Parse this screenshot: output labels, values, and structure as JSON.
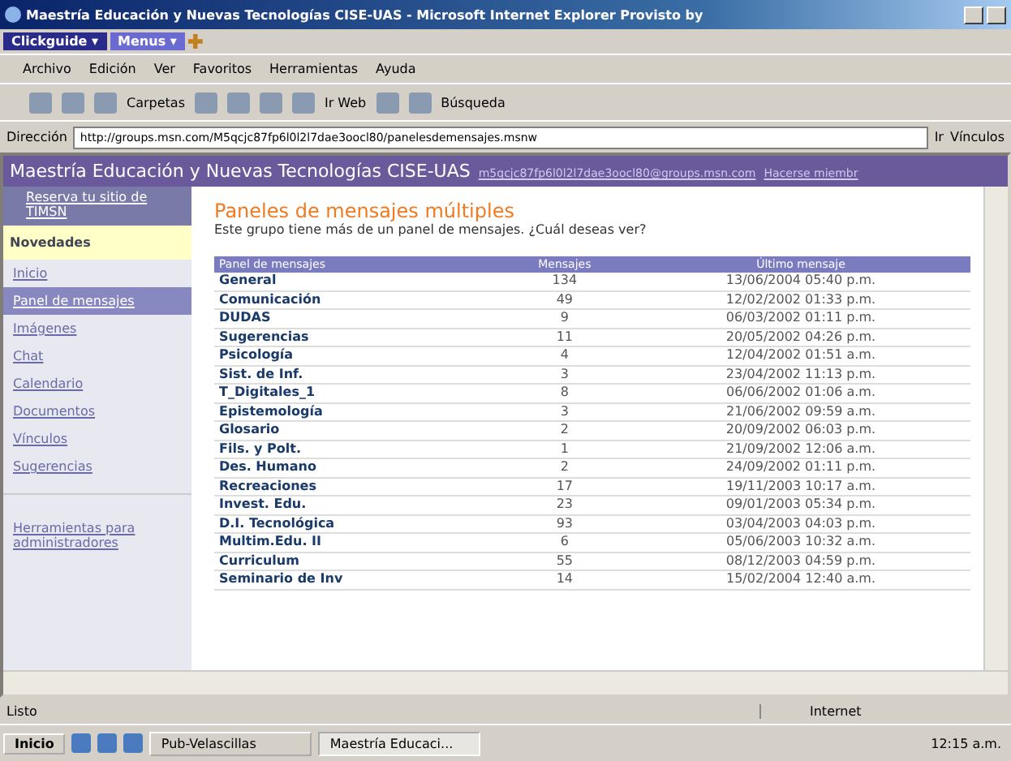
{
  "window": {
    "title": "Maestría Educación y Nuevas Tecnologías CISE-UAS - Microsoft Internet Explorer Provisto by"
  },
  "addon_bar": {
    "items": [
      "Clickguide ▾",
      "Menus ▾"
    ]
  },
  "menu_bar": [
    "Archivo",
    "Edición",
    "Ver",
    "Favoritos",
    "Herramientas",
    "Ayuda"
  ],
  "toolbar": {
    "folders": "Carpetas",
    "web": "Ir Web",
    "search": "Búsqueda"
  },
  "address_bar": {
    "label": "Dirección",
    "url": "http://groups.msn.com/M5qcjc87fp6l0l2l7dae3oocl80/panelesdemensajes.msnw",
    "go": "Ir",
    "links": "Vínculos"
  },
  "site_header": {
    "title": "Maestría Educación y Nuevas Tecnologías CISE-UAS",
    "email": "m5qcjc87fp6l0l2l7dae3oocl80@groups.msn.com",
    "join": "Hacerse miembr"
  },
  "sidebar": {
    "promo": "Reserva tu sitio de TIMSN",
    "news": "Novedades",
    "items": [
      {
        "label": "Inicio",
        "selected": false
      },
      {
        "label": "Panel de mensajes",
        "selected": true
      },
      {
        "label": "Imágenes",
        "selected": false
      },
      {
        "label": "Chat",
        "selected": false
      },
      {
        "label": "Calendario",
        "selected": false
      },
      {
        "label": "Documentos",
        "selected": false
      },
      {
        "label": "Vínculos",
        "selected": false
      },
      {
        "label": "Sugerencias",
        "selected": false
      }
    ],
    "admin": "Herramientas para administradores"
  },
  "content": {
    "heading": "Paneles de mensajes múltiples",
    "intro": "Este grupo tiene más de un panel de mensajes. ¿Cuál deseas ver?"
  },
  "table": {
    "columns": [
      "Panel de mensajes",
      "Mensajes",
      "Último mensaje"
    ],
    "rows": [
      [
        "General",
        "134",
        "13/06/2004 05:40 p.m."
      ],
      [
        "Comunicación",
        "49",
        "12/02/2002 01:33 p.m."
      ],
      [
        "DUDAS",
        "9",
        "06/03/2002 01:11 p.m."
      ],
      [
        "Sugerencias",
        "11",
        "20/05/2002 04:26 p.m."
      ],
      [
        "Psicología",
        "4",
        "12/04/2002 01:51 a.m."
      ],
      [
        "Sist. de Inf.",
        "3",
        "23/04/2002 11:13 p.m."
      ],
      [
        "T_Digitales_1",
        "8",
        "06/06/2002 01:06 a.m."
      ],
      [
        "Epistemología",
        "3",
        "21/06/2002 09:59 a.m."
      ],
      [
        "Glosario",
        "2",
        "20/09/2002 06:03 p.m."
      ],
      [
        "Fils. y Polt.",
        "1",
        "21/09/2002 12:06 a.m."
      ],
      [
        "Des. Humano",
        "2",
        "24/09/2002 01:11 p.m."
      ],
      [
        "Recreaciones",
        "17",
        "19/11/2003 10:17 a.m."
      ],
      [
        "Invest. Edu.",
        "23",
        "09/01/2003 05:34 p.m."
      ],
      [
        "D.I. Tecnológica",
        "93",
        "03/04/2003 04:03 p.m."
      ],
      [
        "Multim.Edu. II",
        "6",
        "05/06/2003 10:32 a.m."
      ],
      [
        "Curriculum",
        "55",
        "08/12/2003 04:59 p.m."
      ],
      [
        "Seminario de Inv",
        "14",
        "15/02/2004 12:40 a.m."
      ]
    ]
  },
  "status_bar": {
    "text": "Listo",
    "zone": "Internet"
  },
  "taskbar": {
    "start": "Inicio",
    "tasks": [
      {
        "label": "Pub-Velascillas",
        "selected": false
      },
      {
        "label": "Maestría Educaci...",
        "selected": true
      }
    ],
    "clock": "12:15 a.m."
  }
}
